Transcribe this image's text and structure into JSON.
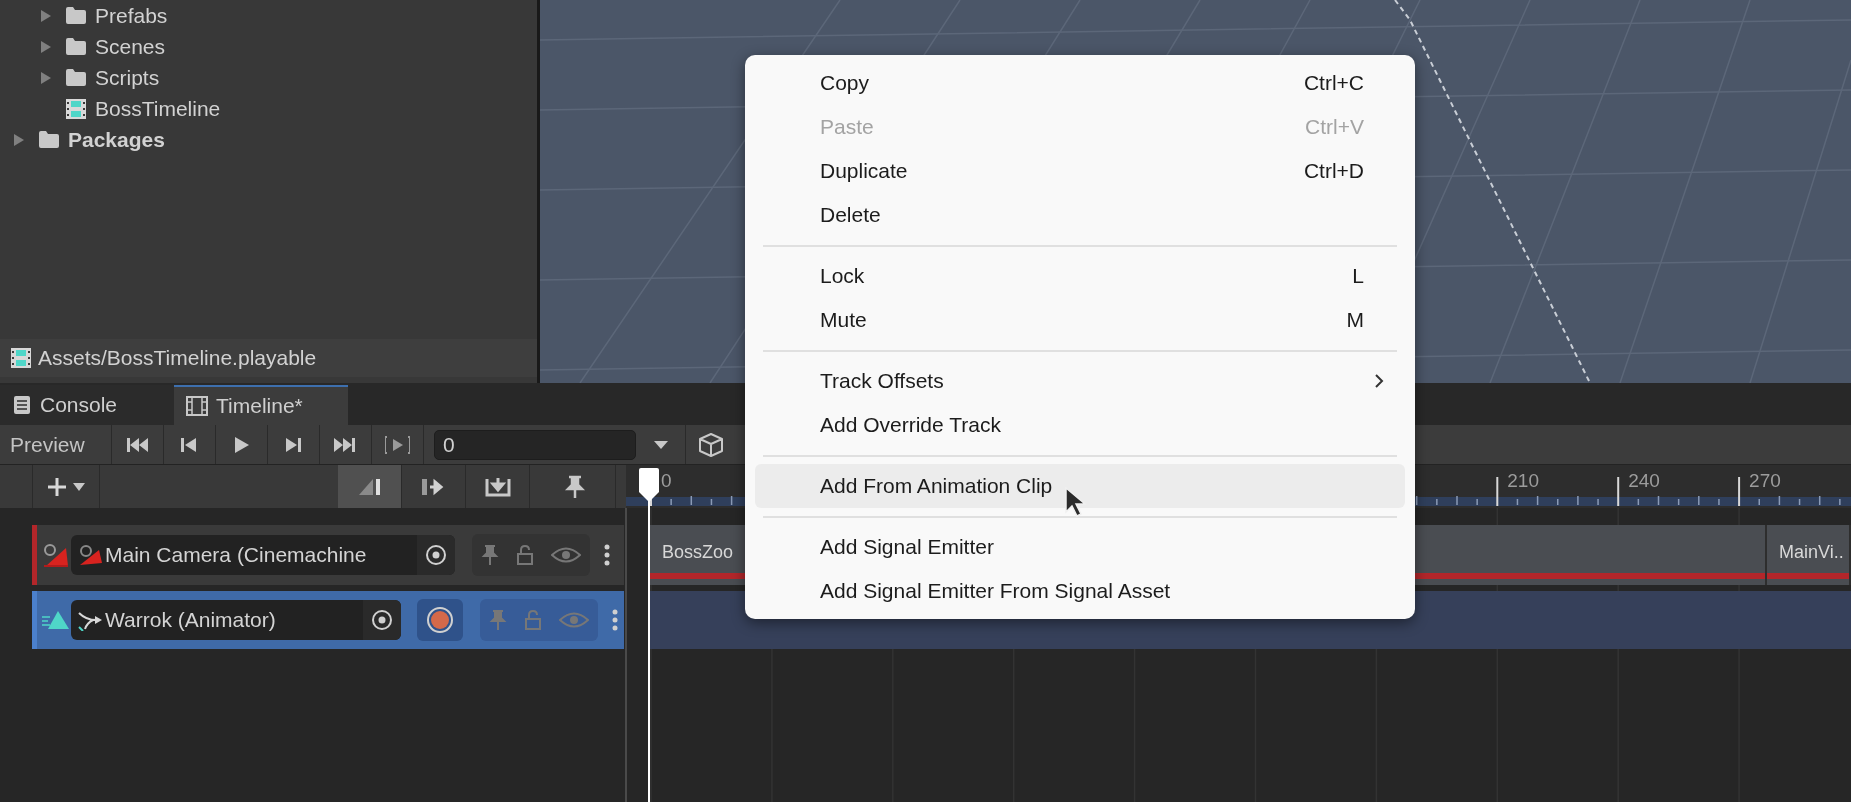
{
  "project": {
    "tree": [
      {
        "children": [
          {
            "label": "Prefabs",
            "kind": "folder",
            "expanded": false
          },
          {
            "label": "Scenes",
            "kind": "folder",
            "expanded": false
          },
          {
            "label": "Scripts",
            "kind": "folder",
            "expanded": false
          },
          {
            "label": "BossTimeline",
            "kind": "timeline"
          }
        ]
      },
      {
        "label": "Packages",
        "kind": "folder",
        "expanded": false
      }
    ],
    "status": "Assets/BossTimeline.playable"
  },
  "tabs": [
    {
      "label": "Console",
      "kind": "console",
      "selected": false
    },
    {
      "label": "Timeline*",
      "kind": "timeline",
      "selected": true
    }
  ],
  "toolbar": {
    "preview": "Preview",
    "frame_field": {
      "value": "0"
    }
  },
  "ruler": {
    "labels": [
      "0",
      "210",
      "240",
      "270"
    ]
  },
  "tracks": [
    {
      "name": "Main Camera (Cinemachine",
      "kind": "cinemachine",
      "selected": false,
      "color": "#b3262a",
      "record_button": false,
      "clips": [
        {
          "label": "BossZoo"
        },
        {
          "label": "MainVi.."
        }
      ]
    },
    {
      "name": "Warrok (Animator)",
      "kind": "animation",
      "selected": true,
      "color": "#4b80cc",
      "record_button": true
    }
  ],
  "context_menu": {
    "groups": [
      [
        {
          "label": "Copy",
          "shortcut": "Ctrl+C",
          "disabled": false,
          "selected": false
        },
        {
          "label": "Paste",
          "shortcut": "Ctrl+V",
          "disabled": true,
          "selected": false
        },
        {
          "label": "Duplicate",
          "shortcut": "Ctrl+D",
          "disabled": false,
          "selected": false
        },
        {
          "label": "Delete",
          "disabled": false,
          "selected": false
        }
      ],
      [
        {
          "label": "Lock",
          "shortcut": "L",
          "disabled": false,
          "selected": false
        },
        {
          "label": "Mute",
          "shortcut": "M",
          "disabled": false,
          "selected": false
        }
      ],
      [
        {
          "label": "Track Offsets",
          "submenu": true,
          "disabled": false,
          "selected": false
        },
        {
          "label": "Add Override Track",
          "disabled": false,
          "selected": false
        }
      ],
      [
        {
          "label": "Add From Animation Clip",
          "disabled": false,
          "selected": true
        }
      ],
      [
        {
          "label": "Add Signal Emitter",
          "disabled": false,
          "selected": false
        },
        {
          "label": "Add Signal Emitter From Signal Asset",
          "disabled": false,
          "selected": false
        }
      ]
    ]
  }
}
